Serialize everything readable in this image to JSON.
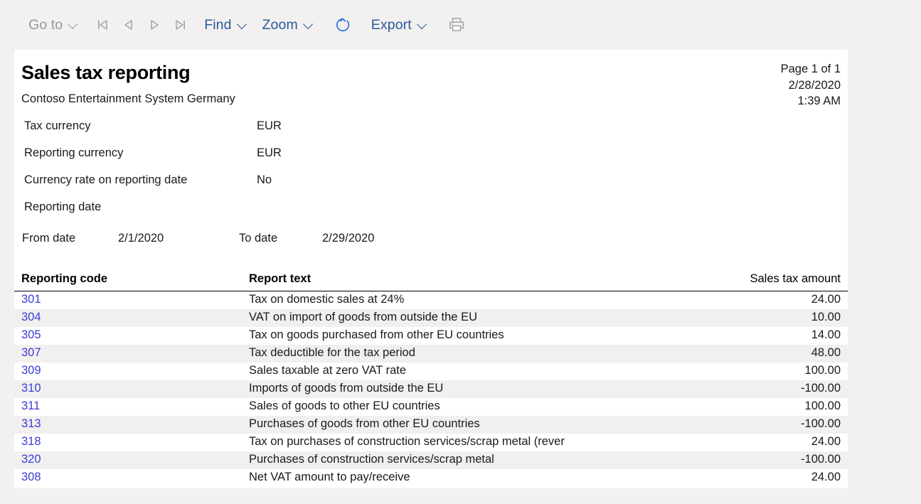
{
  "toolbar": {
    "goto_label": "Go to",
    "first_page_icon": "first-page-icon",
    "previous_page_icon": "previous-page-icon",
    "next_page_icon": "next-page-icon",
    "last_page_icon": "last-page-icon",
    "find_label": "Find",
    "zoom_label": "Zoom",
    "refresh_icon": "refresh-icon",
    "export_label": "Export",
    "print_icon": "print-icon"
  },
  "report": {
    "title": "Sales tax reporting",
    "subtitle": "Contoso Entertainment System Germany",
    "page_info": "Page 1 of 1",
    "date": "2/28/2020",
    "time": "1:39 AM",
    "parameters": [
      {
        "label": "Tax currency",
        "value": "EUR"
      },
      {
        "label": "Reporting currency",
        "value": "EUR"
      },
      {
        "label": "Currency rate on reporting date",
        "value": "No"
      },
      {
        "label": "Reporting date",
        "value": ""
      }
    ],
    "date_range": {
      "from_label": "From date",
      "from_value": "2/1/2020",
      "to_label": "To date",
      "to_value": "2/29/2020"
    },
    "table": {
      "columns": {
        "code": "Reporting code",
        "text": "Report text",
        "amount": "Sales tax amount"
      },
      "rows": [
        {
          "code": "301",
          "text": "Tax on domestic sales at 24%",
          "amount": "24.00"
        },
        {
          "code": "304",
          "text": "VAT on import of goods from outside the EU",
          "amount": "10.00"
        },
        {
          "code": "305",
          "text": "Tax on goods purchased from other EU countries",
          "amount": "14.00"
        },
        {
          "code": "307",
          "text": "Tax deductible for the tax period",
          "amount": "48.00"
        },
        {
          "code": "309",
          "text": "Sales taxable at zero VAT rate",
          "amount": "100.00"
        },
        {
          "code": "310",
          "text": "Imports of goods from outside the EU",
          "amount": "-100.00"
        },
        {
          "code": "311",
          "text": "Sales of goods to other EU countries",
          "amount": "100.00"
        },
        {
          "code": "313",
          "text": "Purchases of goods from other EU countries",
          "amount": "-100.00"
        },
        {
          "code": "318",
          "text": "Tax on purchases of construction services/scrap metal (rever",
          "amount": "24.00"
        },
        {
          "code": "320",
          "text": "Purchases of construction services/scrap metal",
          "amount": "-100.00"
        },
        {
          "code": "308",
          "text": "Net VAT amount to pay/receive",
          "amount": "24.00"
        }
      ]
    }
  },
  "colors": {
    "accent": "#2b579a",
    "link": "#3b3bd4",
    "disabled": "#9a9896",
    "page_background": "#f2f1f0",
    "row_alt": "#f1f0ef"
  }
}
